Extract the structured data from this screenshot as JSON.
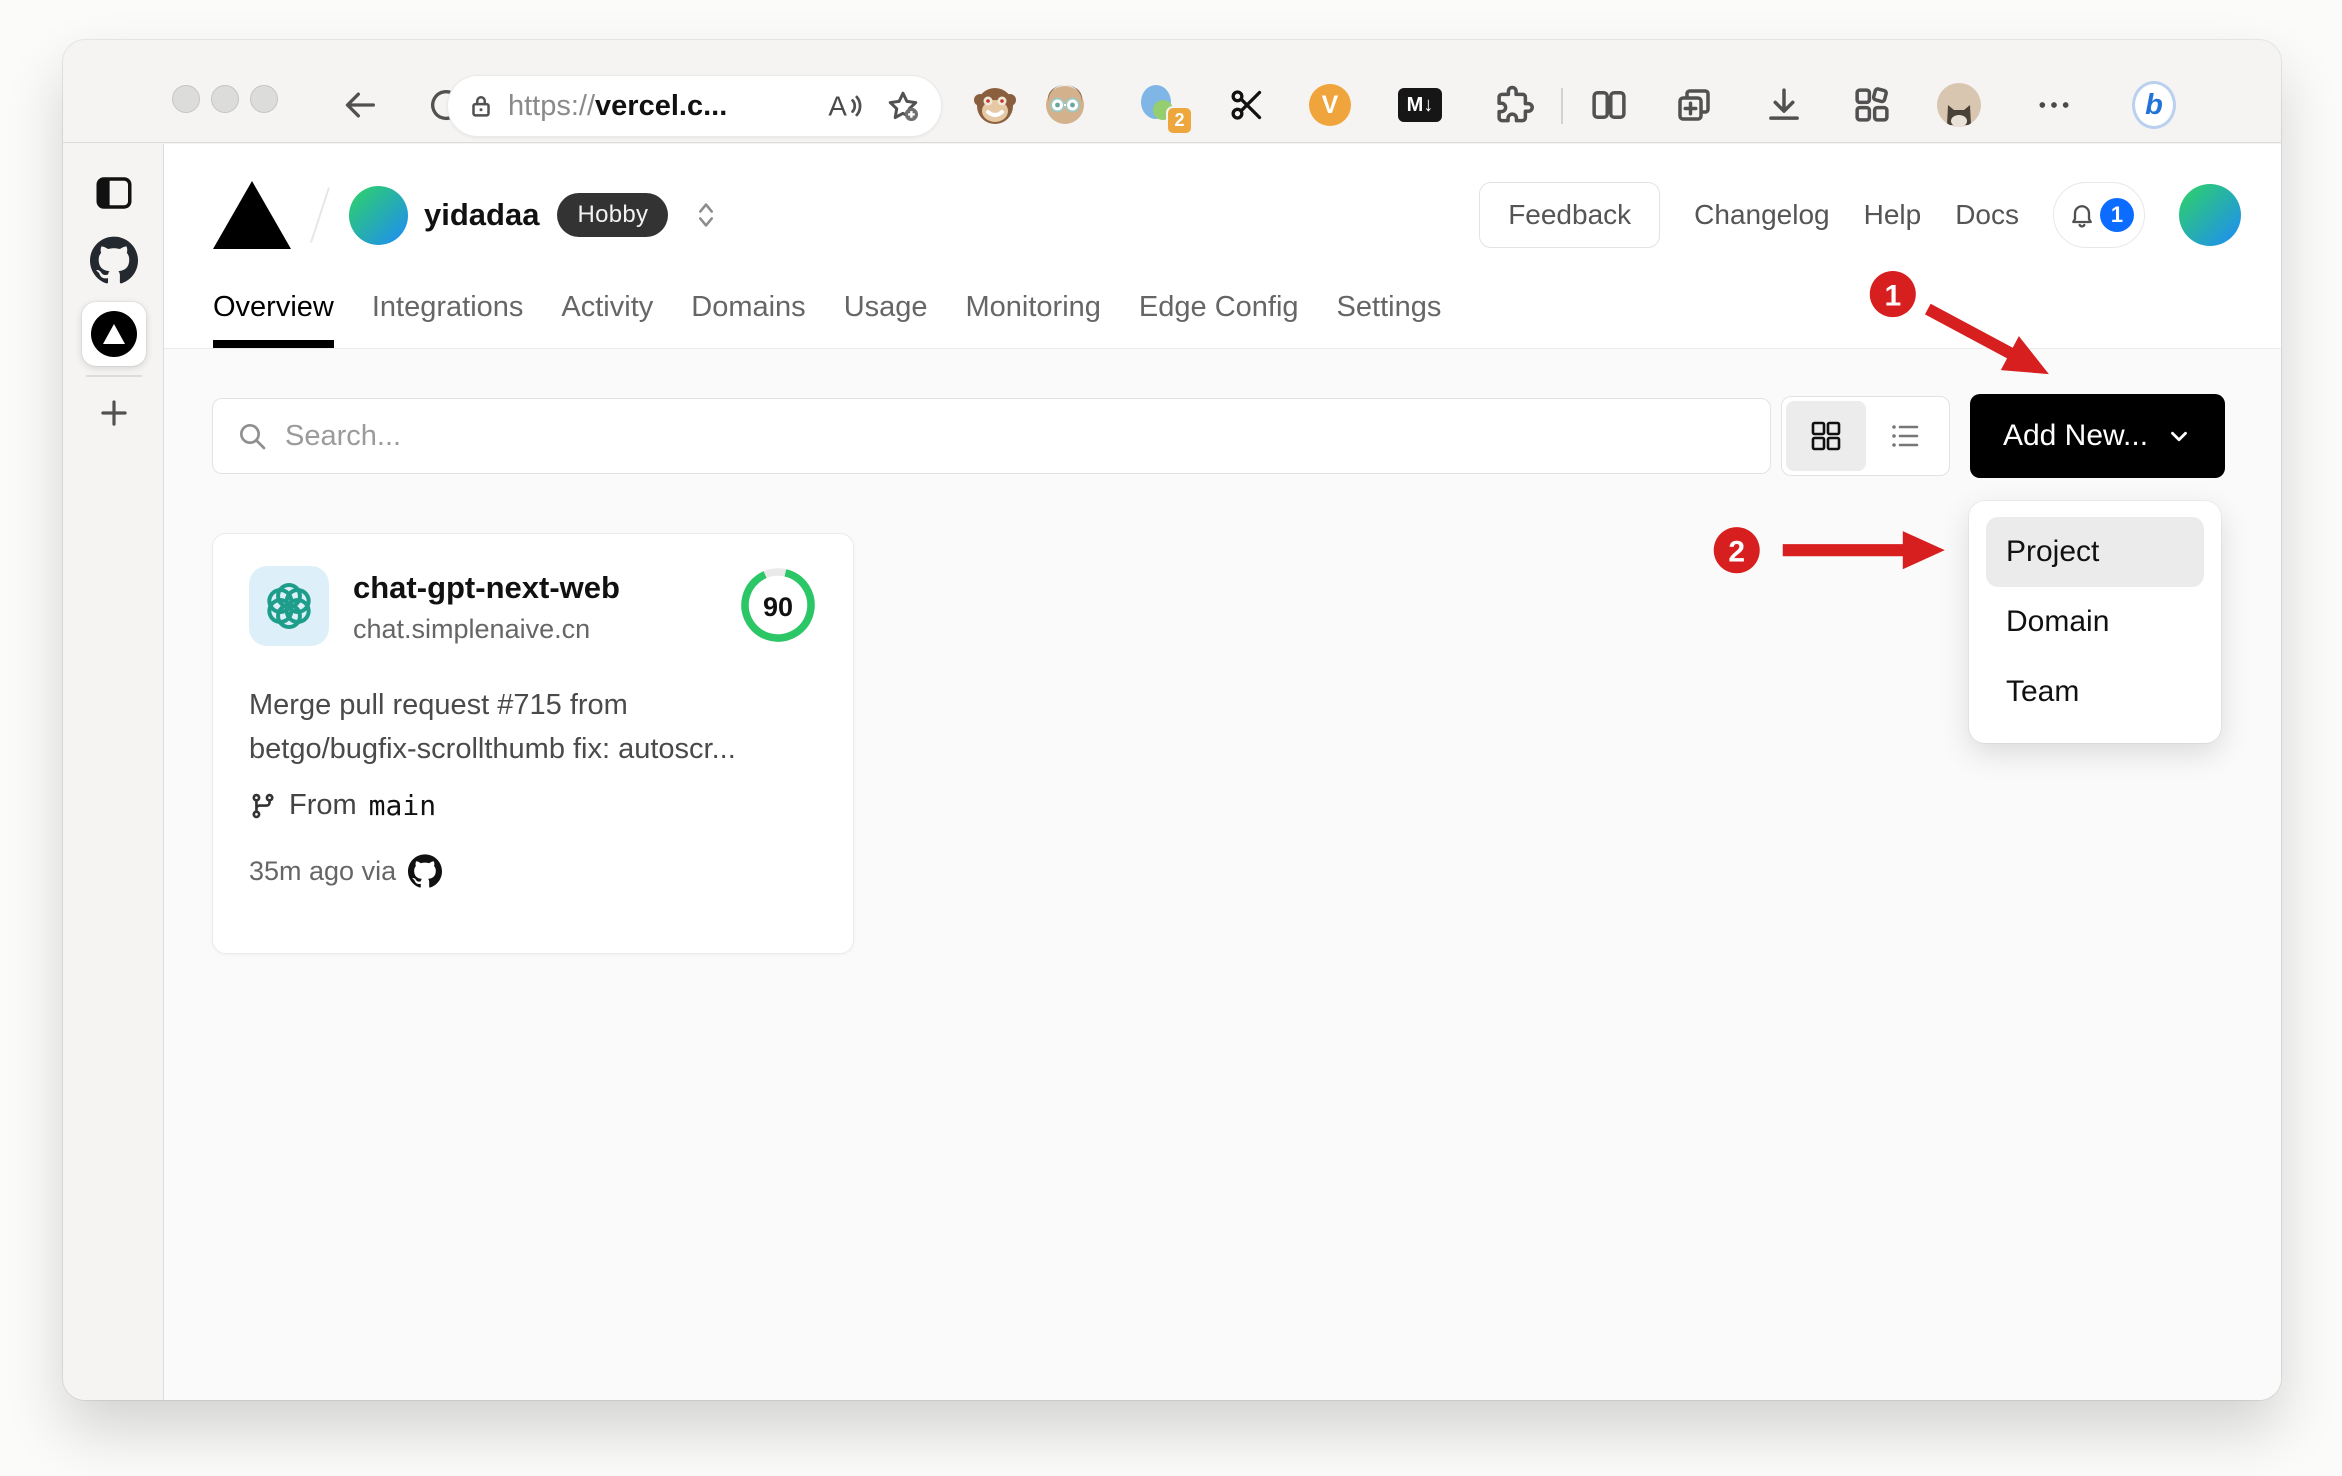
{
  "browser": {
    "url": {
      "scheme": "https://",
      "host": "vercel.c..."
    },
    "extensions": {
      "translate_badge": "2",
      "v_label": "V",
      "markdown_label": "M↓",
      "bing_label": "b"
    }
  },
  "site": {
    "team": {
      "name": "yidadaa",
      "plan": "Hobby"
    },
    "nav": {
      "feedback": "Feedback",
      "changelog": "Changelog",
      "help": "Help",
      "docs": "Docs",
      "notification_count": "1"
    },
    "tabs": [
      "Overview",
      "Integrations",
      "Activity",
      "Domains",
      "Usage",
      "Monitoring",
      "Edge Config",
      "Settings"
    ],
    "toolbar": {
      "search_placeholder": "Search...",
      "add_new": "Add New..."
    },
    "card": {
      "name": "chat-gpt-next-web",
      "domain": "chat.simplenaive.cn",
      "score": "90",
      "commit": "Merge pull request #715 from betgo/bugfix-scrollthumb fix: autoscr...",
      "from_label": "From",
      "branch": "main",
      "time": "35m ago via"
    },
    "dropdown": {
      "items": [
        "Project",
        "Domain",
        "Team"
      ]
    }
  },
  "annotations": {
    "step1": "1",
    "step2": "2",
    "color": "#d71f1f"
  },
  "colors": {
    "add_new_bg": "#000000",
    "score_ring_green": "#2bc665",
    "notification_blue": "#0b6cff",
    "content_bg": "#fafafa"
  }
}
